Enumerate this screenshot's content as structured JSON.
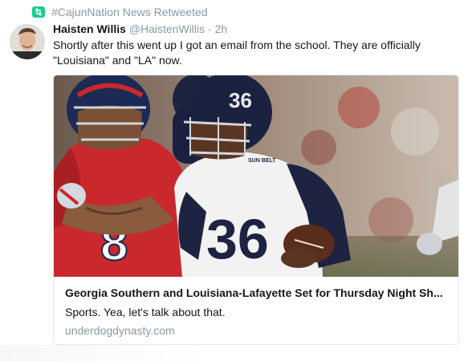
{
  "retweet": {
    "icon": "retweet-icon",
    "text": "#CajunNation News Retweeted",
    "accent": "#19cf86"
  },
  "tweet": {
    "display_name": "Haisten Willis",
    "handle": "@HaistenWillis",
    "separator": "·",
    "time": "2h",
    "text": "Shortly after this went up I got an email from the school. They are officially \"Louisiana\" and \"LA\" now."
  },
  "card": {
    "title": "Georgia Southern and Louisiana-Lafayette Set for Thursday Night Sh...",
    "description": "Sports. Yea, let's talk about that.",
    "domain": "underdogdynasty.com",
    "image": {
      "subject": "football-game-photo",
      "jersey_number_left": "8",
      "jersey_number_right": "36",
      "helmet_number": "36",
      "sun_belt_patch": "SUN BELT"
    }
  },
  "colors": {
    "name": "#14171a",
    "meta": "#8899a6",
    "border": "#e1e8ed"
  }
}
